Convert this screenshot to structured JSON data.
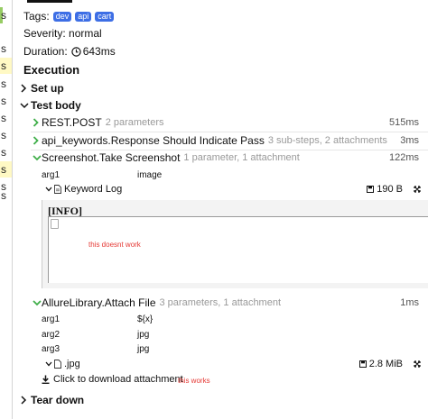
{
  "left_pane": {
    "items": [
      "s",
      "s",
      "s",
      "s",
      "s",
      "s",
      "s",
      "s",
      "s",
      "s",
      "s"
    ]
  },
  "header": {
    "tags_label": "Tags:",
    "tags": [
      "dev",
      "api",
      "cart"
    ],
    "severity": "Severity: normal",
    "duration_label": "Duration:",
    "duration_value": "643ms"
  },
  "execution": {
    "title": "Execution",
    "setup_label": "Set up",
    "test_body_label": "Test body",
    "teardown_label": "Tear down",
    "steps": [
      {
        "name": "REST.POST",
        "meta": "2 parameters",
        "duration": "515ms"
      },
      {
        "name": "api_keywords.Response Should Indicate Pass",
        "meta": "3 sub-steps, 2 attachments",
        "duration": "3ms"
      },
      {
        "name": "Screenshot.Take Screenshot",
        "meta": "1 parameter, 1 attachment",
        "duration": "122ms"
      },
      {
        "name": "AllureLibrary.Attach File",
        "meta": "3 parameters, 1 attachment",
        "duration": "1ms"
      }
    ],
    "screenshot_params": [
      {
        "key": "arg1",
        "value": "image"
      }
    ],
    "keyword_log": {
      "name": "Keyword Log",
      "size": "190 B",
      "info_text": "[INFO]",
      "note": "this doesnt work"
    },
    "attach_params": [
      {
        "key": "arg1",
        "value": "${x}"
      },
      {
        "key": "arg2",
        "value": "jpg"
      },
      {
        "key": "arg3",
        "value": "jpg"
      }
    ],
    "attachment": {
      "name": ".jpg",
      "size": "2.8 MiB",
      "download_label": "Click to download attachment",
      "note": "this works"
    }
  },
  "colors": {
    "tag": "#3d6ee5",
    "passed": "#3fae49",
    "note_red": "#e53935",
    "highlight": "#fff9c4"
  }
}
